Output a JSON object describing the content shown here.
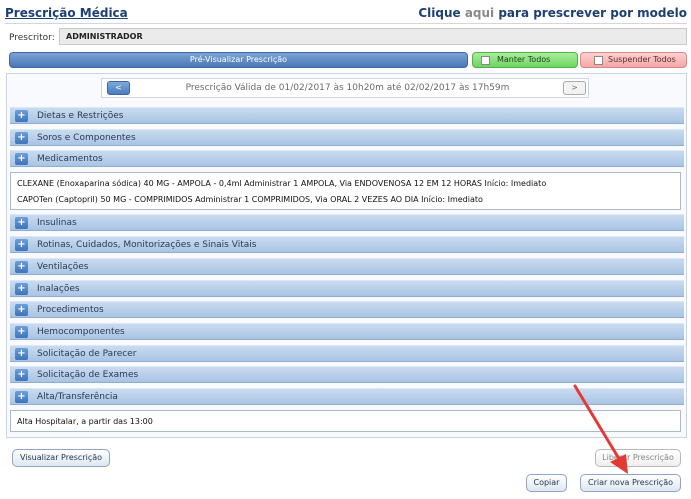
{
  "header": {
    "title": "Prescrição Médica",
    "model_prefix": "Clique ",
    "model_link": "aqui",
    "model_suffix": " para prescrever por modelo"
  },
  "prescritor": {
    "label": "Prescritor:",
    "value": "ADMINISTRADOR"
  },
  "actions": {
    "preview": "Pré-Visualizar Prescrição",
    "keep_all": "Manter Todos",
    "suspend_all": "Suspender Todos"
  },
  "date_nav": {
    "prev": "<",
    "next": ">",
    "text": "Prescrição Válida de 01/02/2017 às 10h20m até 02/02/2017 às 17h59m"
  },
  "sections": [
    {
      "label": "Dietas e Restrições"
    },
    {
      "label": "Soros e Componentes"
    },
    {
      "label": "Medicamentos"
    },
    {
      "label": "Insulinas"
    },
    {
      "label": "Rotinas, Cuidados, Monitorizações e Sinais Vitais"
    },
    {
      "label": "Ventilações"
    },
    {
      "label": "Inalações"
    },
    {
      "label": "Procedimentos"
    },
    {
      "label": "Hemocomponentes"
    },
    {
      "label": "Solicitação de Parecer"
    },
    {
      "label": "Solicitação de Exames"
    },
    {
      "label": "Alta/Transferência"
    }
  ],
  "medicamentos": [
    "CLEXANE (Enoxaparina sódica) 40 MG - AMPOLA - 0,4ml Administrar 1 AMPOLA, Via ENDOVENOSA 12 EM 12 HORAS Início: Imediato",
    "CAPOTen (Captopril) 50 MG - COMPRIMIDOS Administrar 1 COMPRIMIDOS, Via ORAL 2 VEZES AO DIA Início: Imediato"
  ],
  "alta": [
    "Alta Hospitalar, a partir das 13:00"
  ],
  "buttons": {
    "visualizar": "Visualizar Prescrição",
    "liberar": "Liberar Prescrição",
    "copiar": "Copiar",
    "criar": "Criar nova Prescrição"
  },
  "colors": {
    "title": "#1d3f73",
    "section_bar": "#a9c4e3",
    "keep_all": "#6ed462",
    "suspend_all": "#f4a7a7",
    "arrow": "#e23b34"
  }
}
